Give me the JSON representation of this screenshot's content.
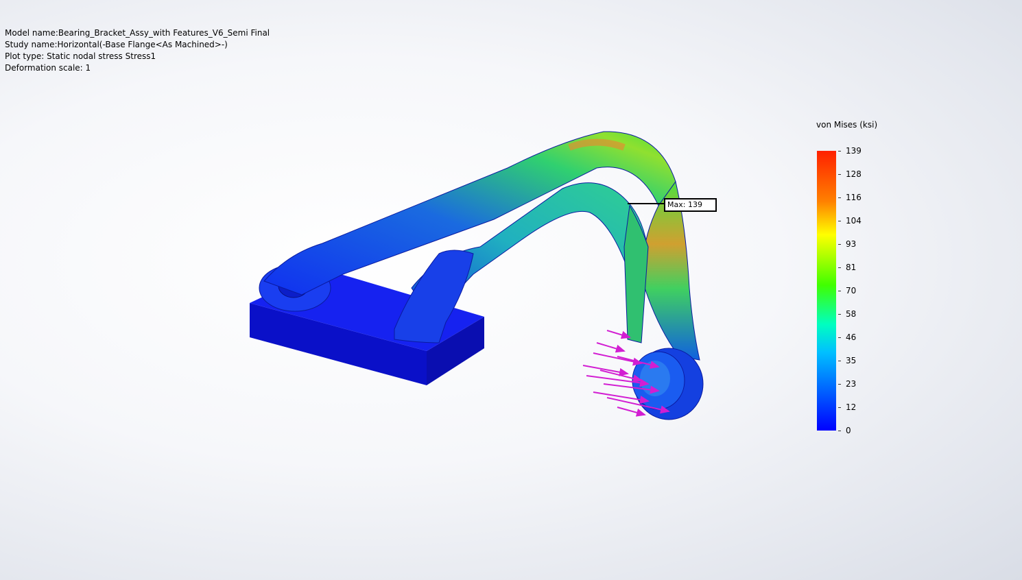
{
  "study_info": {
    "model_name": "Model name:Bearing_Bracket_Assy_with Features_V6_Semi Final",
    "study_name": "Study name:Horizontal(-Base Flange<As Machined>-)",
    "plot_type": "Plot type: Static nodal stress Stress1",
    "deformation_scale": "Deformation scale: 1"
  },
  "legend": {
    "title": "von Mises (ksi)",
    "ticks": [
      "139",
      "128",
      "116",
      "104",
      "93",
      "81",
      "70",
      "58",
      "46",
      "35",
      "23",
      "12",
      "0"
    ],
    "max_color": "#ff2000",
    "min_color": "#0000ff"
  },
  "callout": {
    "label": "Max: 139"
  },
  "colors": {
    "load_arrows": "#d21ed2",
    "low_stress": "#0a14e6",
    "mid_stress": "#40e040",
    "high_stress": "#e06020"
  }
}
